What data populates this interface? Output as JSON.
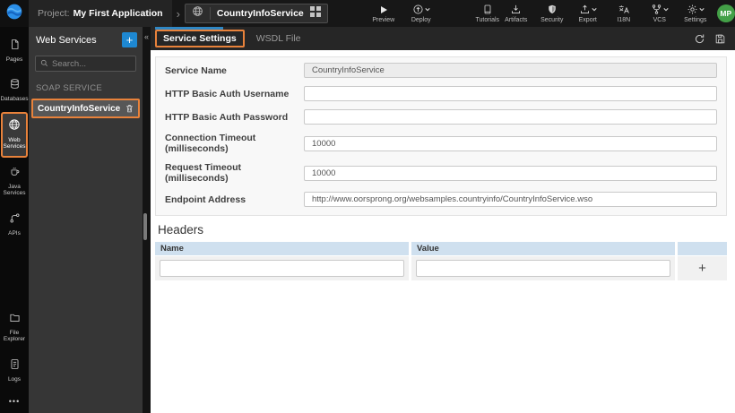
{
  "topbar": {
    "project_label": "Project:",
    "project_name": "My First Application",
    "breadcrumb_chevron": "›",
    "service_tab_label": "CountryInfoService",
    "preview": "Preview",
    "deploy": "Deploy",
    "tutorials": "Tutorials",
    "artifacts": "Artifacts",
    "security": "Security",
    "export": "Export",
    "i18n": "I18N",
    "vcs": "VCS",
    "settings": "Settings",
    "avatar_initials": "MP"
  },
  "sidebar": {
    "items": [
      {
        "label": "Pages",
        "icon": "page-icon",
        "active": false
      },
      {
        "label": "Databases",
        "icon": "database-icon",
        "active": false
      },
      {
        "label": "Web Services",
        "icon": "globe-icon",
        "active": true
      },
      {
        "label": "Java Services",
        "icon": "coffee-icon",
        "active": false
      },
      {
        "label": "APIs",
        "icon": "api-icon",
        "active": false
      },
      {
        "label": "File Explorer",
        "icon": "folder-icon",
        "active": false
      },
      {
        "label": "Logs",
        "icon": "log-icon",
        "active": false
      }
    ],
    "more_glyph": "•••"
  },
  "services_panel": {
    "title": "Web Services",
    "add_button": "+",
    "collapse_glyph": "«",
    "search_placeholder": "Search...",
    "section_label": "SOAP SERVICE",
    "service_name": "CountryInfoService"
  },
  "main": {
    "tabs": [
      {
        "label": "Service Settings",
        "active": true
      },
      {
        "label": "WSDL File",
        "active": false
      }
    ],
    "form": {
      "fields": [
        {
          "label": "Service Name",
          "value": "CountryInfoService",
          "disabled": true
        },
        {
          "label": "HTTP Basic Auth Username",
          "value": "",
          "disabled": false
        },
        {
          "label": "HTTP Basic Auth Password",
          "value": "",
          "disabled": false
        },
        {
          "label": "Connection Timeout (milliseconds)",
          "value": "10000",
          "disabled": false
        },
        {
          "label": "Request Timeout (milliseconds)",
          "value": "10000",
          "disabled": false
        },
        {
          "label": "Endpoint Address",
          "value": "http://www.oorsprong.org/websamples.countryinfo/CountryInfoService.wso",
          "disabled": false
        }
      ]
    },
    "headers_section": {
      "title": "Headers",
      "columns": [
        "Name",
        "Value"
      ],
      "add_button": "+"
    }
  },
  "colors": {
    "highlight_orange": "#E8823B",
    "accent_blue": "#2F87C4",
    "add_button_blue": "#1E88D2",
    "avatar_green": "#43A047",
    "table_header_blue": "#CFE0EF"
  }
}
